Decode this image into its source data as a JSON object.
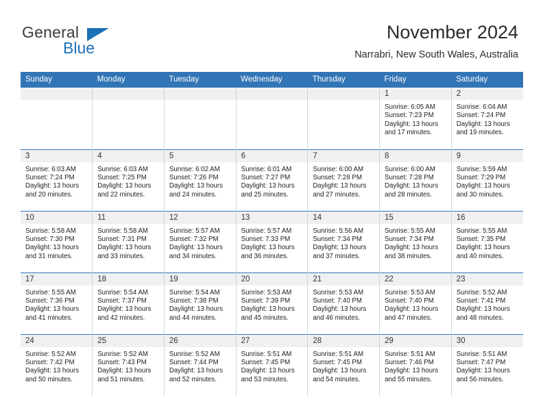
{
  "brand": {
    "name_part1": "General",
    "name_part2": "Blue",
    "triangle_color": "#1b70b8"
  },
  "header": {
    "title": "November 2024",
    "subtitle": "Narrabri, New South Wales, Australia",
    "accent_color": "#3275b6"
  },
  "weekday_headers": [
    "Sunday",
    "Monday",
    "Tuesday",
    "Wednesday",
    "Thursday",
    "Friday",
    "Saturday"
  ],
  "weeks": [
    [
      {
        "day": "",
        "empty": true
      },
      {
        "day": "",
        "empty": true
      },
      {
        "day": "",
        "empty": true
      },
      {
        "day": "",
        "empty": true
      },
      {
        "day": "",
        "empty": true
      },
      {
        "day": "1",
        "sunrise": "Sunrise: 6:05 AM",
        "sunset": "Sunset: 7:23 PM",
        "daylight_line1": "Daylight: 13 hours",
        "daylight_line2": "and 17 minutes."
      },
      {
        "day": "2",
        "sunrise": "Sunrise: 6:04 AM",
        "sunset": "Sunset: 7:24 PM",
        "daylight_line1": "Daylight: 13 hours",
        "daylight_line2": "and 19 minutes."
      }
    ],
    [
      {
        "day": "3",
        "sunrise": "Sunrise: 6:03 AM",
        "sunset": "Sunset: 7:24 PM",
        "daylight_line1": "Daylight: 13 hours",
        "daylight_line2": "and 20 minutes."
      },
      {
        "day": "4",
        "sunrise": "Sunrise: 6:03 AM",
        "sunset": "Sunset: 7:25 PM",
        "daylight_line1": "Daylight: 13 hours",
        "daylight_line2": "and 22 minutes."
      },
      {
        "day": "5",
        "sunrise": "Sunrise: 6:02 AM",
        "sunset": "Sunset: 7:26 PM",
        "daylight_line1": "Daylight: 13 hours",
        "daylight_line2": "and 24 minutes."
      },
      {
        "day": "6",
        "sunrise": "Sunrise: 6:01 AM",
        "sunset": "Sunset: 7:27 PM",
        "daylight_line1": "Daylight: 13 hours",
        "daylight_line2": "and 25 minutes."
      },
      {
        "day": "7",
        "sunrise": "Sunrise: 6:00 AM",
        "sunset": "Sunset: 7:28 PM",
        "daylight_line1": "Daylight: 13 hours",
        "daylight_line2": "and 27 minutes."
      },
      {
        "day": "8",
        "sunrise": "Sunrise: 6:00 AM",
        "sunset": "Sunset: 7:28 PM",
        "daylight_line1": "Daylight: 13 hours",
        "daylight_line2": "and 28 minutes."
      },
      {
        "day": "9",
        "sunrise": "Sunrise: 5:59 AM",
        "sunset": "Sunset: 7:29 PM",
        "daylight_line1": "Daylight: 13 hours",
        "daylight_line2": "and 30 minutes."
      }
    ],
    [
      {
        "day": "10",
        "sunrise": "Sunrise: 5:58 AM",
        "sunset": "Sunset: 7:30 PM",
        "daylight_line1": "Daylight: 13 hours",
        "daylight_line2": "and 31 minutes."
      },
      {
        "day": "11",
        "sunrise": "Sunrise: 5:58 AM",
        "sunset": "Sunset: 7:31 PM",
        "daylight_line1": "Daylight: 13 hours",
        "daylight_line2": "and 33 minutes."
      },
      {
        "day": "12",
        "sunrise": "Sunrise: 5:57 AM",
        "sunset": "Sunset: 7:32 PM",
        "daylight_line1": "Daylight: 13 hours",
        "daylight_line2": "and 34 minutes."
      },
      {
        "day": "13",
        "sunrise": "Sunrise: 5:57 AM",
        "sunset": "Sunset: 7:33 PM",
        "daylight_line1": "Daylight: 13 hours",
        "daylight_line2": "and 36 minutes."
      },
      {
        "day": "14",
        "sunrise": "Sunrise: 5:56 AM",
        "sunset": "Sunset: 7:34 PM",
        "daylight_line1": "Daylight: 13 hours",
        "daylight_line2": "and 37 minutes."
      },
      {
        "day": "15",
        "sunrise": "Sunrise: 5:55 AM",
        "sunset": "Sunset: 7:34 PM",
        "daylight_line1": "Daylight: 13 hours",
        "daylight_line2": "and 38 minutes."
      },
      {
        "day": "16",
        "sunrise": "Sunrise: 5:55 AM",
        "sunset": "Sunset: 7:35 PM",
        "daylight_line1": "Daylight: 13 hours",
        "daylight_line2": "and 40 minutes."
      }
    ],
    [
      {
        "day": "17",
        "sunrise": "Sunrise: 5:55 AM",
        "sunset": "Sunset: 7:36 PM",
        "daylight_line1": "Daylight: 13 hours",
        "daylight_line2": "and 41 minutes."
      },
      {
        "day": "18",
        "sunrise": "Sunrise: 5:54 AM",
        "sunset": "Sunset: 7:37 PM",
        "daylight_line1": "Daylight: 13 hours",
        "daylight_line2": "and 42 minutes."
      },
      {
        "day": "19",
        "sunrise": "Sunrise: 5:54 AM",
        "sunset": "Sunset: 7:38 PM",
        "daylight_line1": "Daylight: 13 hours",
        "daylight_line2": "and 44 minutes."
      },
      {
        "day": "20",
        "sunrise": "Sunrise: 5:53 AM",
        "sunset": "Sunset: 7:39 PM",
        "daylight_line1": "Daylight: 13 hours",
        "daylight_line2": "and 45 minutes."
      },
      {
        "day": "21",
        "sunrise": "Sunrise: 5:53 AM",
        "sunset": "Sunset: 7:40 PM",
        "daylight_line1": "Daylight: 13 hours",
        "daylight_line2": "and 46 minutes."
      },
      {
        "day": "22",
        "sunrise": "Sunrise: 5:53 AM",
        "sunset": "Sunset: 7:40 PM",
        "daylight_line1": "Daylight: 13 hours",
        "daylight_line2": "and 47 minutes."
      },
      {
        "day": "23",
        "sunrise": "Sunrise: 5:52 AM",
        "sunset": "Sunset: 7:41 PM",
        "daylight_line1": "Daylight: 13 hours",
        "daylight_line2": "and 48 minutes."
      }
    ],
    [
      {
        "day": "24",
        "sunrise": "Sunrise: 5:52 AM",
        "sunset": "Sunset: 7:42 PM",
        "daylight_line1": "Daylight: 13 hours",
        "daylight_line2": "and 50 minutes."
      },
      {
        "day": "25",
        "sunrise": "Sunrise: 5:52 AM",
        "sunset": "Sunset: 7:43 PM",
        "daylight_line1": "Daylight: 13 hours",
        "daylight_line2": "and 51 minutes."
      },
      {
        "day": "26",
        "sunrise": "Sunrise: 5:52 AM",
        "sunset": "Sunset: 7:44 PM",
        "daylight_line1": "Daylight: 13 hours",
        "daylight_line2": "and 52 minutes."
      },
      {
        "day": "27",
        "sunrise": "Sunrise: 5:51 AM",
        "sunset": "Sunset: 7:45 PM",
        "daylight_line1": "Daylight: 13 hours",
        "daylight_line2": "and 53 minutes."
      },
      {
        "day": "28",
        "sunrise": "Sunrise: 5:51 AM",
        "sunset": "Sunset: 7:45 PM",
        "daylight_line1": "Daylight: 13 hours",
        "daylight_line2": "and 54 minutes."
      },
      {
        "day": "29",
        "sunrise": "Sunrise: 5:51 AM",
        "sunset": "Sunset: 7:46 PM",
        "daylight_line1": "Daylight: 13 hours",
        "daylight_line2": "and 55 minutes."
      },
      {
        "day": "30",
        "sunrise": "Sunrise: 5:51 AM",
        "sunset": "Sunset: 7:47 PM",
        "daylight_line1": "Daylight: 13 hours",
        "daylight_line2": "and 56 minutes."
      }
    ]
  ]
}
